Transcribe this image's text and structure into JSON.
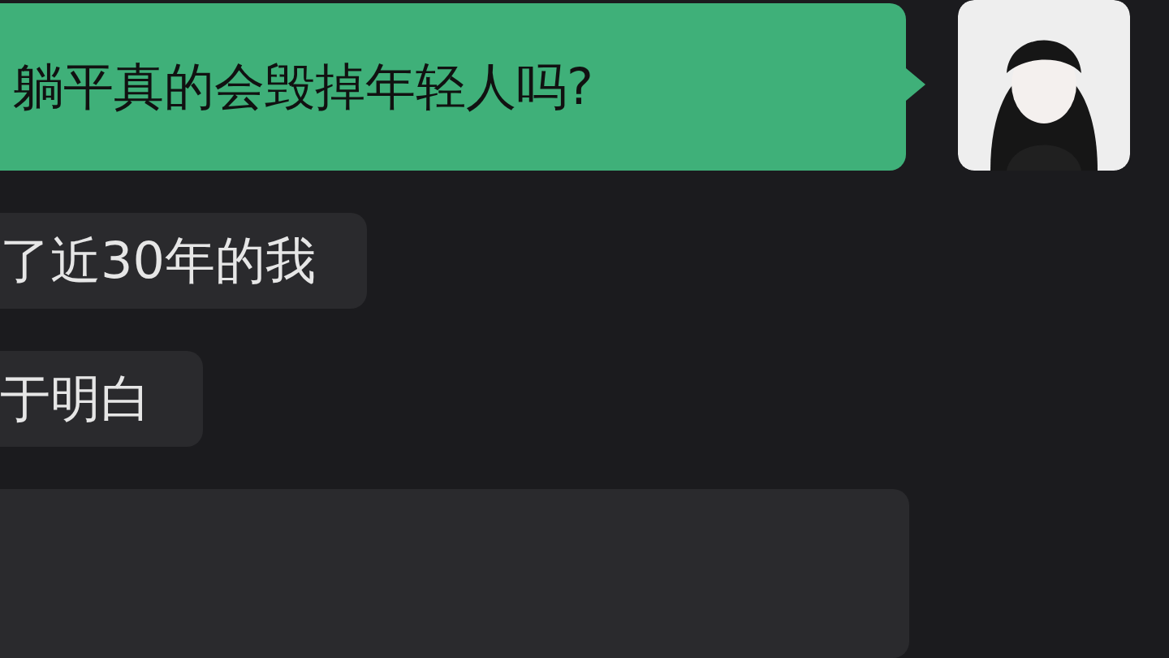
{
  "messages": [
    {
      "kind": "sent",
      "text": "躺平真的会毁掉年轻人吗?"
    },
    {
      "kind": "received",
      "text": "了近30年的我"
    },
    {
      "kind": "received",
      "text": "于明白"
    },
    {
      "kind": "received"
    }
  ]
}
